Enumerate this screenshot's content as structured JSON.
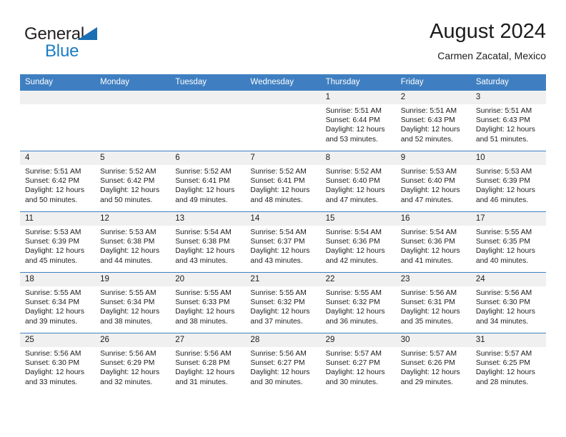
{
  "brand": {
    "word_one": "General",
    "word_two": "Blue",
    "triangle_icon": "triangle-icon",
    "color_dark": "#231f20",
    "color_blue": "#1a7cc4"
  },
  "header": {
    "title": "August 2024",
    "subtitle": "Carmen Zacatal, Mexico"
  },
  "theme": {
    "header_bg": "#3f7fc1",
    "header_text": "#ffffff",
    "daynum_bg": "#f0f0f0",
    "cell_bg": "#ffffff"
  },
  "weekdays": [
    "Sunday",
    "Monday",
    "Tuesday",
    "Wednesday",
    "Thursday",
    "Friday",
    "Saturday"
  ],
  "labels": {
    "sunrise_prefix": "Sunrise:",
    "sunset_prefix": "Sunset:",
    "daylight_prefix": "Daylight:"
  },
  "weeks": [
    [
      {
        "day": "",
        "blank": true,
        "sunrise": "",
        "sunset": "",
        "daylight_line1": "",
        "daylight_line2": ""
      },
      {
        "day": "",
        "blank": true,
        "sunrise": "",
        "sunset": "",
        "daylight_line1": "",
        "daylight_line2": ""
      },
      {
        "day": "",
        "blank": true,
        "sunrise": "",
        "sunset": "",
        "daylight_line1": "",
        "daylight_line2": ""
      },
      {
        "day": "",
        "blank": true,
        "sunrise": "",
        "sunset": "",
        "daylight_line1": "",
        "daylight_line2": ""
      },
      {
        "day": "1",
        "blank": false,
        "sunrise": "Sunrise: 5:51 AM",
        "sunset": "Sunset: 6:44 PM",
        "daylight_line1": "Daylight: 12 hours",
        "daylight_line2": "and 53 minutes."
      },
      {
        "day": "2",
        "blank": false,
        "sunrise": "Sunrise: 5:51 AM",
        "sunset": "Sunset: 6:43 PM",
        "daylight_line1": "Daylight: 12 hours",
        "daylight_line2": "and 52 minutes."
      },
      {
        "day": "3",
        "blank": false,
        "sunrise": "Sunrise: 5:51 AM",
        "sunset": "Sunset: 6:43 PM",
        "daylight_line1": "Daylight: 12 hours",
        "daylight_line2": "and 51 minutes."
      }
    ],
    [
      {
        "day": "4",
        "blank": false,
        "sunrise": "Sunrise: 5:51 AM",
        "sunset": "Sunset: 6:42 PM",
        "daylight_line1": "Daylight: 12 hours",
        "daylight_line2": "and 50 minutes."
      },
      {
        "day": "5",
        "blank": false,
        "sunrise": "Sunrise: 5:52 AM",
        "sunset": "Sunset: 6:42 PM",
        "daylight_line1": "Daylight: 12 hours",
        "daylight_line2": "and 50 minutes."
      },
      {
        "day": "6",
        "blank": false,
        "sunrise": "Sunrise: 5:52 AM",
        "sunset": "Sunset: 6:41 PM",
        "daylight_line1": "Daylight: 12 hours",
        "daylight_line2": "and 49 minutes."
      },
      {
        "day": "7",
        "blank": false,
        "sunrise": "Sunrise: 5:52 AM",
        "sunset": "Sunset: 6:41 PM",
        "daylight_line1": "Daylight: 12 hours",
        "daylight_line2": "and 48 minutes."
      },
      {
        "day": "8",
        "blank": false,
        "sunrise": "Sunrise: 5:52 AM",
        "sunset": "Sunset: 6:40 PM",
        "daylight_line1": "Daylight: 12 hours",
        "daylight_line2": "and 47 minutes."
      },
      {
        "day": "9",
        "blank": false,
        "sunrise": "Sunrise: 5:53 AM",
        "sunset": "Sunset: 6:40 PM",
        "daylight_line1": "Daylight: 12 hours",
        "daylight_line2": "and 47 minutes."
      },
      {
        "day": "10",
        "blank": false,
        "sunrise": "Sunrise: 5:53 AM",
        "sunset": "Sunset: 6:39 PM",
        "daylight_line1": "Daylight: 12 hours",
        "daylight_line2": "and 46 minutes."
      }
    ],
    [
      {
        "day": "11",
        "blank": false,
        "sunrise": "Sunrise: 5:53 AM",
        "sunset": "Sunset: 6:39 PM",
        "daylight_line1": "Daylight: 12 hours",
        "daylight_line2": "and 45 minutes."
      },
      {
        "day": "12",
        "blank": false,
        "sunrise": "Sunrise: 5:53 AM",
        "sunset": "Sunset: 6:38 PM",
        "daylight_line1": "Daylight: 12 hours",
        "daylight_line2": "and 44 minutes."
      },
      {
        "day": "13",
        "blank": false,
        "sunrise": "Sunrise: 5:54 AM",
        "sunset": "Sunset: 6:38 PM",
        "daylight_line1": "Daylight: 12 hours",
        "daylight_line2": "and 43 minutes."
      },
      {
        "day": "14",
        "blank": false,
        "sunrise": "Sunrise: 5:54 AM",
        "sunset": "Sunset: 6:37 PM",
        "daylight_line1": "Daylight: 12 hours",
        "daylight_line2": "and 43 minutes."
      },
      {
        "day": "15",
        "blank": false,
        "sunrise": "Sunrise: 5:54 AM",
        "sunset": "Sunset: 6:36 PM",
        "daylight_line1": "Daylight: 12 hours",
        "daylight_line2": "and 42 minutes."
      },
      {
        "day": "16",
        "blank": false,
        "sunrise": "Sunrise: 5:54 AM",
        "sunset": "Sunset: 6:36 PM",
        "daylight_line1": "Daylight: 12 hours",
        "daylight_line2": "and 41 minutes."
      },
      {
        "day": "17",
        "blank": false,
        "sunrise": "Sunrise: 5:55 AM",
        "sunset": "Sunset: 6:35 PM",
        "daylight_line1": "Daylight: 12 hours",
        "daylight_line2": "and 40 minutes."
      }
    ],
    [
      {
        "day": "18",
        "blank": false,
        "sunrise": "Sunrise: 5:55 AM",
        "sunset": "Sunset: 6:34 PM",
        "daylight_line1": "Daylight: 12 hours",
        "daylight_line2": "and 39 minutes."
      },
      {
        "day": "19",
        "blank": false,
        "sunrise": "Sunrise: 5:55 AM",
        "sunset": "Sunset: 6:34 PM",
        "daylight_line1": "Daylight: 12 hours",
        "daylight_line2": "and 38 minutes."
      },
      {
        "day": "20",
        "blank": false,
        "sunrise": "Sunrise: 5:55 AM",
        "sunset": "Sunset: 6:33 PM",
        "daylight_line1": "Daylight: 12 hours",
        "daylight_line2": "and 38 minutes."
      },
      {
        "day": "21",
        "blank": false,
        "sunrise": "Sunrise: 5:55 AM",
        "sunset": "Sunset: 6:32 PM",
        "daylight_line1": "Daylight: 12 hours",
        "daylight_line2": "and 37 minutes."
      },
      {
        "day": "22",
        "blank": false,
        "sunrise": "Sunrise: 5:55 AM",
        "sunset": "Sunset: 6:32 PM",
        "daylight_line1": "Daylight: 12 hours",
        "daylight_line2": "and 36 minutes."
      },
      {
        "day": "23",
        "blank": false,
        "sunrise": "Sunrise: 5:56 AM",
        "sunset": "Sunset: 6:31 PM",
        "daylight_line1": "Daylight: 12 hours",
        "daylight_line2": "and 35 minutes."
      },
      {
        "day": "24",
        "blank": false,
        "sunrise": "Sunrise: 5:56 AM",
        "sunset": "Sunset: 6:30 PM",
        "daylight_line1": "Daylight: 12 hours",
        "daylight_line2": "and 34 minutes."
      }
    ],
    [
      {
        "day": "25",
        "blank": false,
        "sunrise": "Sunrise: 5:56 AM",
        "sunset": "Sunset: 6:30 PM",
        "daylight_line1": "Daylight: 12 hours",
        "daylight_line2": "and 33 minutes."
      },
      {
        "day": "26",
        "blank": false,
        "sunrise": "Sunrise: 5:56 AM",
        "sunset": "Sunset: 6:29 PM",
        "daylight_line1": "Daylight: 12 hours",
        "daylight_line2": "and 32 minutes."
      },
      {
        "day": "27",
        "blank": false,
        "sunrise": "Sunrise: 5:56 AM",
        "sunset": "Sunset: 6:28 PM",
        "daylight_line1": "Daylight: 12 hours",
        "daylight_line2": "and 31 minutes."
      },
      {
        "day": "28",
        "blank": false,
        "sunrise": "Sunrise: 5:56 AM",
        "sunset": "Sunset: 6:27 PM",
        "daylight_line1": "Daylight: 12 hours",
        "daylight_line2": "and 30 minutes."
      },
      {
        "day": "29",
        "blank": false,
        "sunrise": "Sunrise: 5:57 AM",
        "sunset": "Sunset: 6:27 PM",
        "daylight_line1": "Daylight: 12 hours",
        "daylight_line2": "and 30 minutes."
      },
      {
        "day": "30",
        "blank": false,
        "sunrise": "Sunrise: 5:57 AM",
        "sunset": "Sunset: 6:26 PM",
        "daylight_line1": "Daylight: 12 hours",
        "daylight_line2": "and 29 minutes."
      },
      {
        "day": "31",
        "blank": false,
        "sunrise": "Sunrise: 5:57 AM",
        "sunset": "Sunset: 6:25 PM",
        "daylight_line1": "Daylight: 12 hours",
        "daylight_line2": "and 28 minutes."
      }
    ]
  ]
}
